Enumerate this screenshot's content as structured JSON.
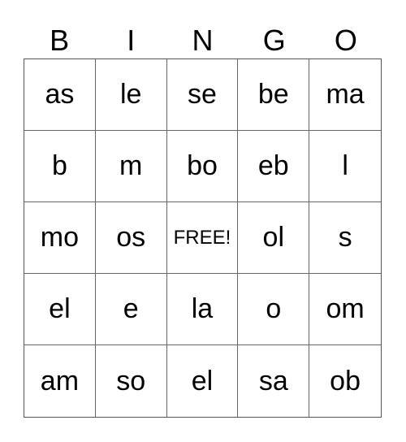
{
  "header": [
    "B",
    "I",
    "N",
    "G",
    "O"
  ],
  "rows": [
    [
      "as",
      "le",
      "se",
      "be",
      "ma"
    ],
    [
      "b",
      "m",
      "bo",
      "eb",
      "l"
    ],
    [
      "mo",
      "os",
      "FREE!",
      "ol",
      "s"
    ],
    [
      "el",
      "e",
      "la",
      "o",
      "om"
    ],
    [
      "am",
      "so",
      "el",
      "sa",
      "ob"
    ]
  ]
}
